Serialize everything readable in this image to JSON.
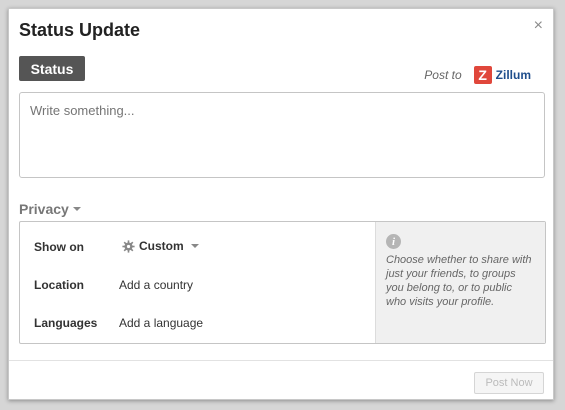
{
  "dialog": {
    "title": "Status Update",
    "close_icon": "close-icon",
    "close_glyph": "×"
  },
  "composer": {
    "tab_label": "Status",
    "post_to_label": "Post to",
    "target_logo_letter": "Z",
    "target_name": "Zillum",
    "placeholder": "Write something...",
    "brand_colors": {
      "logo_bg": "#e0473b",
      "name": "#1f4e8c"
    }
  },
  "privacy": {
    "toggle_label": "Privacy",
    "show_on_label": "Show on",
    "show_on_value": "Custom",
    "location_label": "Location",
    "location_value": "Add a country",
    "languages_label": "Languages",
    "languages_value": "Add a language",
    "info_icon_glyph": "i",
    "info_text": "Choose whether to share with just your friends, to groups you belong to, or to public who visits your profile."
  },
  "footer": {
    "post_button_label": "Post Now"
  }
}
